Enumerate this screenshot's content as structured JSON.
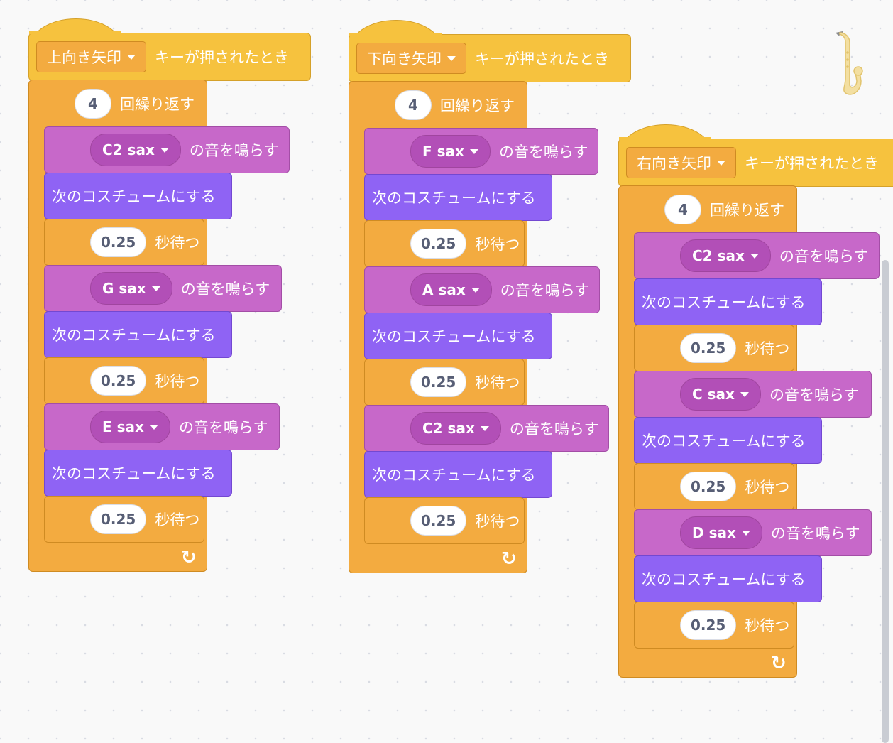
{
  "scripts": [
    {
      "event": {
        "key": "上向き矢印",
        "label": "キーが押されたとき"
      },
      "repeat": {
        "count": "4",
        "label": "回繰り返す"
      },
      "steps": [
        {
          "sound": "C2 sax",
          "play_label": "の音を鳴らす",
          "costume_label": "次のコスチュームにする",
          "wait": "0.25",
          "wait_label": "秒待つ"
        },
        {
          "sound": "G sax",
          "play_label": "の音を鳴らす",
          "costume_label": "次のコスチュームにする",
          "wait": "0.25",
          "wait_label": "秒待つ"
        },
        {
          "sound": "E sax",
          "play_label": "の音を鳴らす",
          "costume_label": "次のコスチュームにする",
          "wait": "0.25",
          "wait_label": "秒待つ"
        }
      ]
    },
    {
      "event": {
        "key": "下向き矢印",
        "label": "キーが押されたとき"
      },
      "repeat": {
        "count": "4",
        "label": "回繰り返す"
      },
      "steps": [
        {
          "sound": "F sax",
          "play_label": "の音を鳴らす",
          "costume_label": "次のコスチュームにする",
          "wait": "0.25",
          "wait_label": "秒待つ"
        },
        {
          "sound": "A sax",
          "play_label": "の音を鳴らす",
          "costume_label": "次のコスチュームにする",
          "wait": "0.25",
          "wait_label": "秒待つ"
        },
        {
          "sound": "C2 sax",
          "play_label": "の音を鳴らす",
          "costume_label": "次のコスチュームにする",
          "wait": "0.25",
          "wait_label": "秒待つ"
        }
      ]
    },
    {
      "event": {
        "key": "右向き矢印",
        "label": "キーが押されたとき"
      },
      "repeat": {
        "count": "4",
        "label": "回繰り返す"
      },
      "steps": [
        {
          "sound": "C2 sax",
          "play_label": "の音を鳴らす",
          "costume_label": "次のコスチュームにする",
          "wait": "0.25",
          "wait_label": "秒待つ"
        },
        {
          "sound": "C sax",
          "play_label": "の音を鳴らす",
          "costume_label": "次のコスチュームにする",
          "wait": "0.25",
          "wait_label": "秒待つ"
        },
        {
          "sound": "D sax",
          "play_label": "の音を鳴らす",
          "costume_label": "次のコスチュームにする",
          "wait": "0.25",
          "wait_label": "秒待つ"
        }
      ]
    }
  ],
  "colors": {
    "events": "#f6c23e",
    "control": "#f3ab40",
    "sound": "#c768c9",
    "looks": "#8f63f4"
  },
  "icons": {
    "loop_end": "loop-arrow-icon",
    "sprite": "saxophone-icon",
    "dropdown": "dropdown-triangle-icon"
  }
}
